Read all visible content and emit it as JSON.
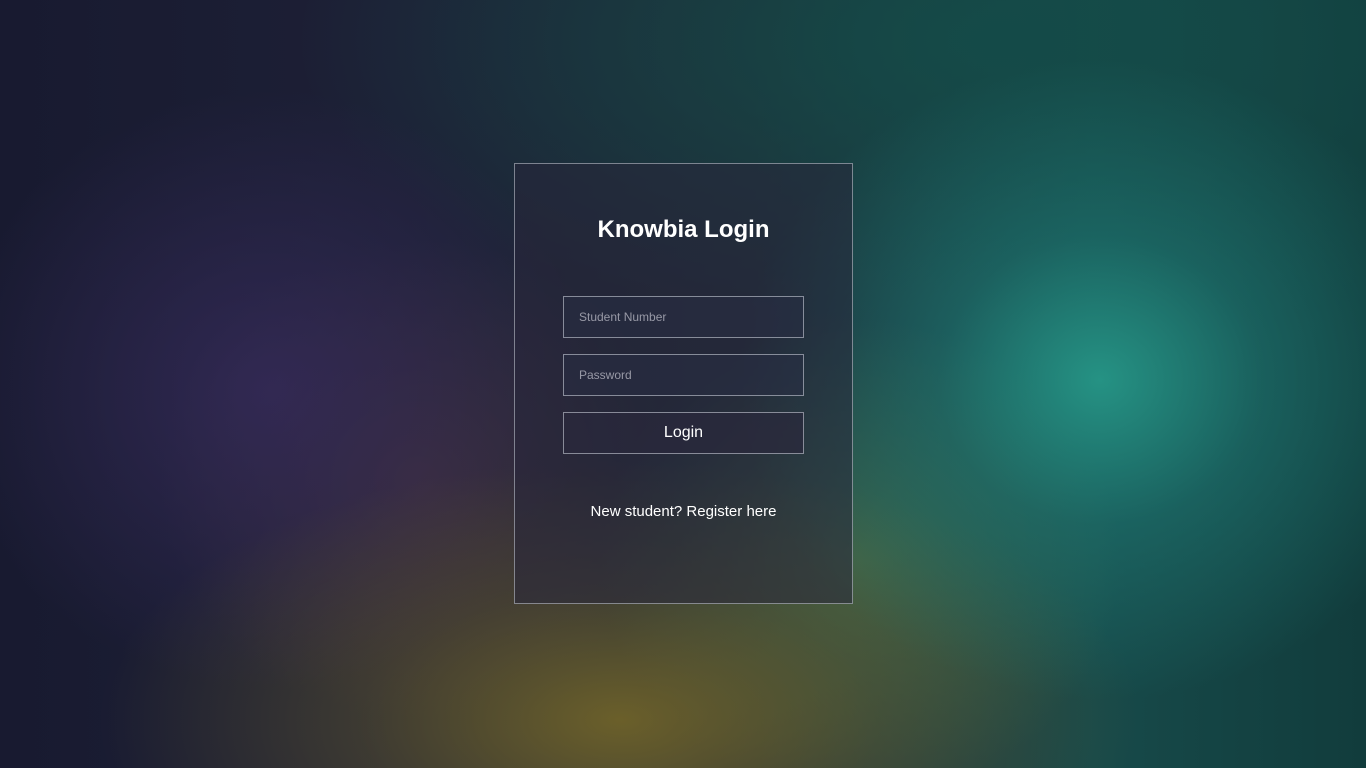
{
  "login_card": {
    "title": "Knowbia Login",
    "student_number": {
      "value": "",
      "placeholder": "Student Number"
    },
    "password": {
      "value": "",
      "placeholder": "Password"
    },
    "login_button_label": "Login",
    "register_link_text": "New student? Register here"
  },
  "colors": {
    "text": "#ffffff",
    "card_border": "#c8cdd7"
  }
}
